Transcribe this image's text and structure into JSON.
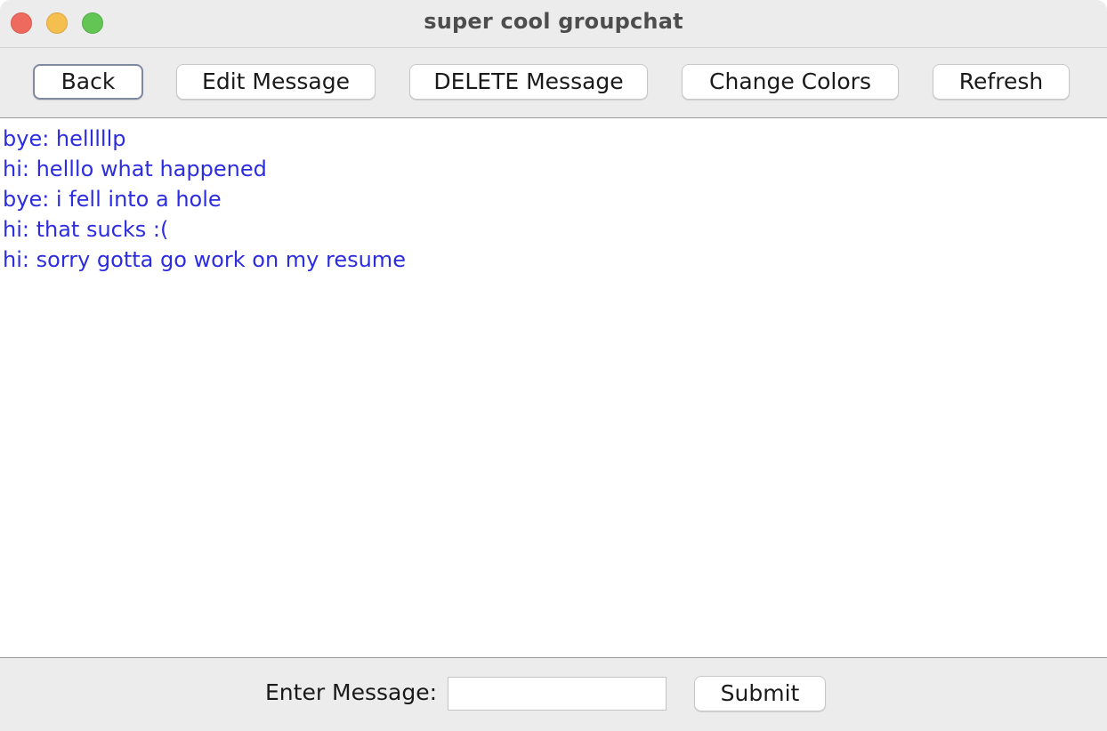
{
  "window": {
    "title": "super cool groupchat"
  },
  "toolbar": {
    "back_label": "Back",
    "edit_label": "Edit Message",
    "delete_label": "DELETE Message",
    "colors_label": "Change Colors",
    "refresh_label": "Refresh"
  },
  "chat": {
    "text_color": "#2d2de0",
    "messages": [
      "bye: helllllp",
      "hi: helllo what happened",
      "bye: i fell into a hole",
      "hi: that sucks :(",
      "hi: sorry gotta go work on my resume"
    ]
  },
  "composer": {
    "label": "Enter Message:",
    "value": "",
    "submit_label": "Submit"
  },
  "colors": {
    "close": "#ee6a5f",
    "minimize": "#f5bf4f",
    "maximize": "#62c554"
  }
}
